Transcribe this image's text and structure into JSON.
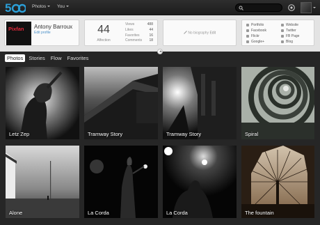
{
  "nav": {
    "photos_label": "Photos",
    "you_label": "You"
  },
  "profile": {
    "brand_text": "Pixfan",
    "name": "Antony Barroux",
    "edit_profile": "Edit profile",
    "affection_value": "44",
    "affection_label": "Affection",
    "stats": [
      {
        "label": "Views",
        "value": "488"
      },
      {
        "label": "Likes",
        "value": "44"
      },
      {
        "label": "Favorites",
        "value": "16"
      },
      {
        "label": "Comments",
        "value": "18"
      }
    ],
    "bio_text": "No biography",
    "bio_edit": "Edit",
    "links_col1": [
      "Portfolio",
      "Facebook",
      "Flickr",
      "Google+"
    ],
    "links_col2": [
      "Website",
      "Twitter",
      "FB Page",
      "Blog"
    ]
  },
  "tabs": [
    "Photos",
    "Stories",
    "Flow",
    "Favorites"
  ],
  "photos": [
    {
      "caption": "Letz Zep"
    },
    {
      "caption": "Tramway Story"
    },
    {
      "caption": "Tramway Story"
    },
    {
      "caption": "Spiral"
    },
    {
      "caption": "Alone"
    },
    {
      "caption": "La Corda"
    },
    {
      "caption": "La Corda"
    },
    {
      "caption": "The fountain"
    }
  ],
  "icons": {
    "logo": "500px-logo",
    "search": "search-icon",
    "upload": "upload-icon",
    "notifications": "notifications-icon"
  },
  "colors": {
    "brand_blue": "#2b9fd8",
    "pixfan_red": "#e2283a",
    "link_blue": "#4a90c8"
  }
}
